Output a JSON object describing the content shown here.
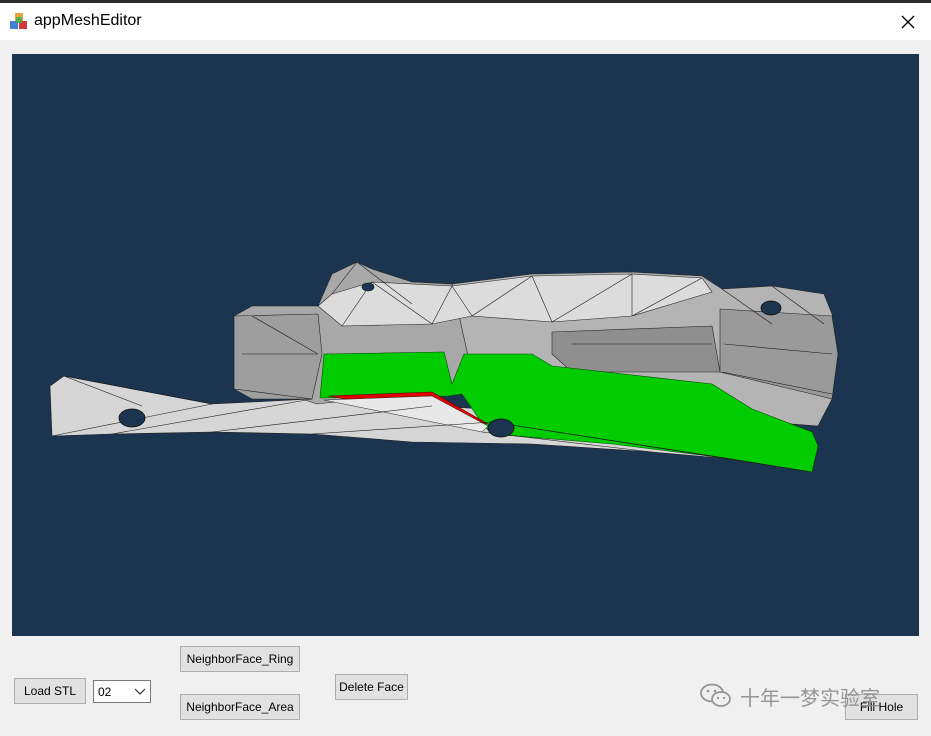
{
  "window": {
    "title": "appMeshEditor",
    "close_glyph": "✕",
    "icon": "app-cubes-icon"
  },
  "viewport": {
    "background": "#1b3450",
    "mesh_color": "#d9d9d9",
    "selected_ring_color": "#00cc00",
    "selected_face_color": "#e00000"
  },
  "controls": {
    "load_stl": "Load STL",
    "combo_value": "02",
    "neighbor_ring": "NeighborFace_Ring",
    "neighbor_area": "NeighborFace_Area",
    "delete_face": "Delete Face",
    "fill_hole": "Fill Hole"
  },
  "watermark": {
    "text": "十年一梦实验室",
    "icon": "wechat-icon"
  }
}
